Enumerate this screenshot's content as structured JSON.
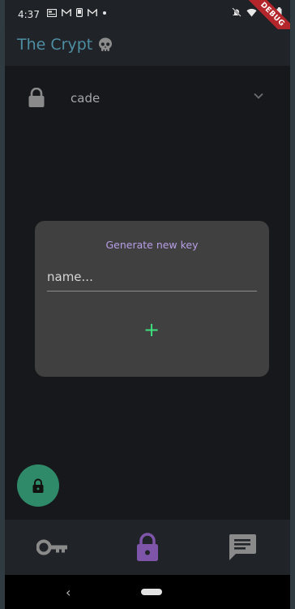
{
  "status_bar": {
    "time": "4:37",
    "debug_label": "DEBUG"
  },
  "app_bar": {
    "title": "The Crypt",
    "title_icon": "skull-icon",
    "title_color": "#4e8ea3"
  },
  "key_selector": {
    "selected": "cade",
    "icon": "lock-icon"
  },
  "dialog": {
    "title": "Generate new key",
    "name_placeholder": "name...",
    "name_value": "",
    "add_label": "+"
  },
  "fab": {
    "icon": "lock-icon",
    "color": "#2f8a69"
  },
  "bottom_nav": {
    "items": [
      {
        "icon": "key-icon",
        "active": false
      },
      {
        "icon": "lock-icon",
        "active": true
      },
      {
        "icon": "message-icon",
        "active": false
      }
    ],
    "active_color": "#7e55a8",
    "inactive_color": "#8a8a8a"
  },
  "system_nav": {
    "back_label": "‹"
  }
}
